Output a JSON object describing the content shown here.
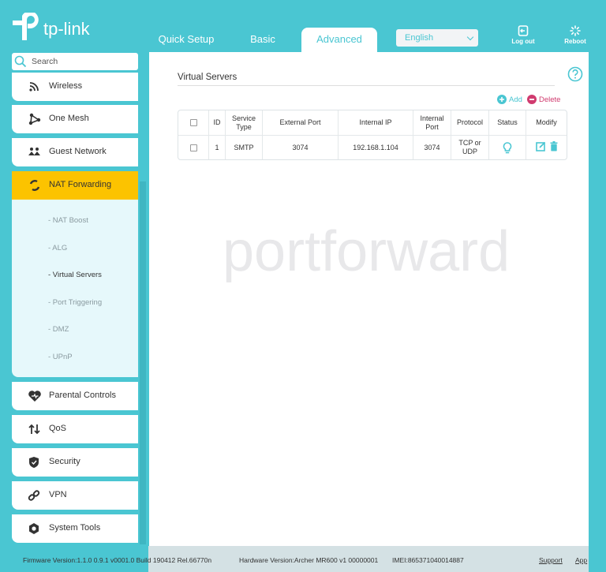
{
  "brand": {
    "logo_text": "tp-link",
    "accent": "#4ac6d2",
    "highlight": "#fcc300",
    "delete_color": "#d03b6f"
  },
  "header": {
    "tabs": [
      {
        "label": "Quick Setup",
        "active": false
      },
      {
        "label": "Basic",
        "active": false
      },
      {
        "label": "Advanced",
        "active": true
      }
    ],
    "language": {
      "selected": "English"
    },
    "logout_label": "Log out",
    "reboot_label": "Reboot"
  },
  "sidebar": {
    "search_placeholder": "Search",
    "items": [
      {
        "label": "Wireless",
        "icon": "wireless-icon"
      },
      {
        "label": "One Mesh",
        "icon": "mesh-icon"
      },
      {
        "label": "Guest Network",
        "icon": "guest-network-icon"
      },
      {
        "label": "NAT Forwarding",
        "icon": "nat-forwarding-icon",
        "active": true
      },
      {
        "label": "Parental Controls",
        "icon": "parental-controls-icon"
      },
      {
        "label": "QoS",
        "icon": "qos-icon"
      },
      {
        "label": "Security",
        "icon": "shield-icon"
      },
      {
        "label": "VPN",
        "icon": "vpn-link-icon"
      },
      {
        "label": "System Tools",
        "icon": "gear-icon"
      }
    ],
    "submenu": [
      {
        "label": "- NAT Boost"
      },
      {
        "label": "- ALG"
      },
      {
        "label": "- Virtual Servers",
        "current": true
      },
      {
        "label": "- Port Triggering"
      },
      {
        "label": "- DMZ"
      },
      {
        "label": "- UPnP"
      }
    ]
  },
  "main": {
    "title": "Virtual Servers",
    "add_label": "Add",
    "delete_label": "Delete",
    "table": {
      "headers": [
        "",
        "ID",
        "Service Type",
        "External Port",
        "Internal IP",
        "Internal Port",
        "Protocol",
        "Status",
        "Modify"
      ],
      "rows": [
        {
          "id": "1",
          "service_type": "SMTP",
          "external_port": "3074",
          "internal_ip": "192.168.1.104",
          "internal_port": "3074",
          "protocol": "TCP or UDP",
          "status": "enabled"
        }
      ]
    },
    "watermark": "portforward"
  },
  "footer": {
    "firmware": "Firmware Version:1.1.0 0.9.1 v0001.0 Build 190412 Rel.66770n",
    "hardware": "Hardware Version:Archer MR600 v1 00000001",
    "imei": "IMEI:865371040014887",
    "support_label": "Support",
    "app_label": "App"
  }
}
